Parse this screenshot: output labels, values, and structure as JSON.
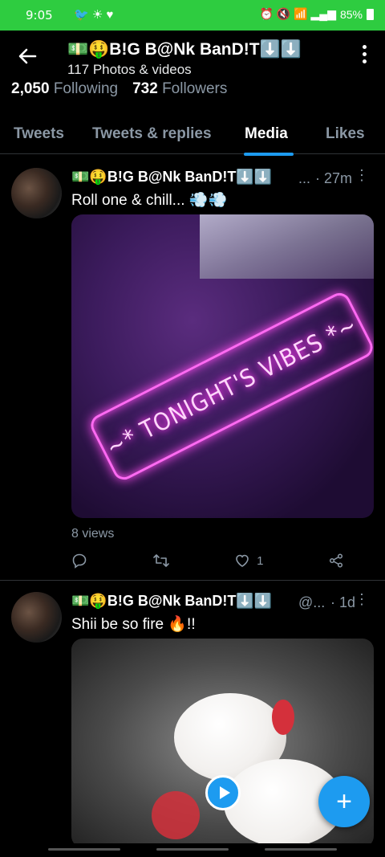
{
  "status_bar": {
    "time": "9:05",
    "notification_icons": [
      "twitter-icon",
      "sun-icon",
      "heart-icon"
    ],
    "notification_glyphs": "🐦 ☀ ♥",
    "right_glyphs": "⏰ 🔇 📶 ▂▄▆",
    "battery": "85%"
  },
  "profile": {
    "name": "💵🤑B!G B@Nk BanD!T⬇️⬇️",
    "subtitle": "117 Photos & videos",
    "following_count": "2,050",
    "following_label": "Following",
    "followers_count": "732",
    "followers_label": "Followers"
  },
  "tabs": [
    {
      "label": "Tweets",
      "active": false
    },
    {
      "label": "Tweets & replies",
      "active": false
    },
    {
      "label": "Media",
      "active": true
    },
    {
      "label": "Likes",
      "active": false
    }
  ],
  "tweets": [
    {
      "name": "💵🤑B!G B@Nk BanD!T⬇️⬇️",
      "handle": "...",
      "time": "· 27m",
      "text": "Roll one & chill... 💨💨",
      "media_text": "~* TONIGHT'S VIBES *~",
      "views": "8 views",
      "likes": "1"
    },
    {
      "name": "💵🤑B!G B@Nk BanD!T⬇️⬇️",
      "handle": "@...",
      "time": "· 1d",
      "text": "Shii be so fire 🔥!!"
    }
  ],
  "fab_label": "+",
  "colors": {
    "accent": "#1d9bf0",
    "status_bar": "#2ecc40",
    "background": "#000000",
    "secondary_text": "#8b98a5"
  }
}
